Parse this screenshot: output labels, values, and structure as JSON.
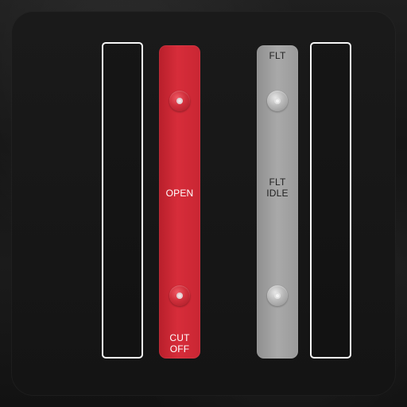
{
  "controls": {
    "left_lever": {
      "middle_label": "OPEN",
      "bottom_label": "CUT\nOFF",
      "color": "#d72d3a"
    },
    "right_lever": {
      "top_label": "FLT",
      "middle_label": "FLT\nIDLE",
      "color": "#a9a9a9"
    },
    "frame_color": "#f7f7f7"
  }
}
